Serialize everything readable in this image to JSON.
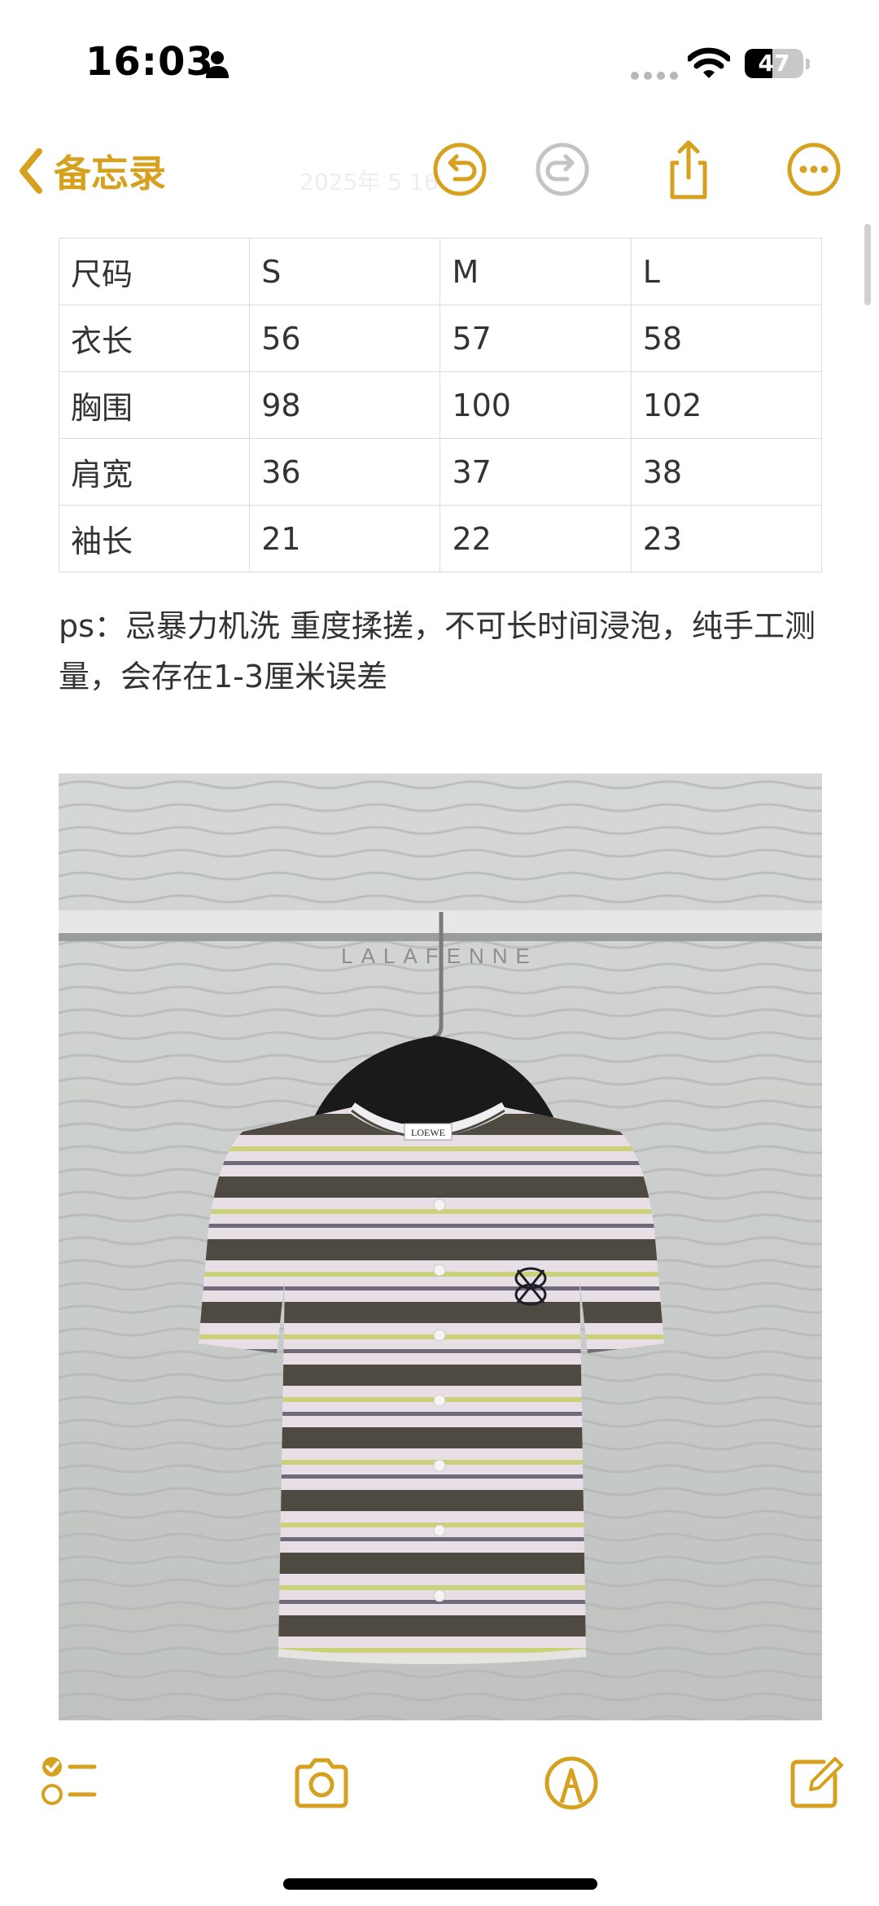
{
  "status": {
    "time": "16:03",
    "battery": 47
  },
  "nav": {
    "back_label": "备忘录",
    "ghost_title": "2025年 5 16"
  },
  "table": {
    "rows": [
      [
        "尺码",
        "S",
        "M",
        "L"
      ],
      [
        "衣长",
        "56",
        "57",
        "58"
      ],
      [
        "胸围",
        "98",
        "100",
        "102"
      ],
      [
        "肩宽",
        "36",
        "37",
        "38"
      ],
      [
        "袖长",
        "21",
        "22",
        "23"
      ]
    ]
  },
  "note": {
    "text": "ps：忌暴力机洗 重度揉搓，不可长时间浸泡，纯手工测量，会存在1-3厘米误差"
  },
  "photo": {
    "watermark": "LALAFENNE",
    "label_text": "LOEWE"
  },
  "colors": {
    "accent": "#d6a11e"
  },
  "icons": {
    "nav": [
      "undo-icon",
      "redo-icon",
      "share-icon",
      "more-icon"
    ],
    "toolbar": [
      "checklist-icon",
      "camera-icon",
      "markup-icon",
      "compose-icon"
    ]
  }
}
